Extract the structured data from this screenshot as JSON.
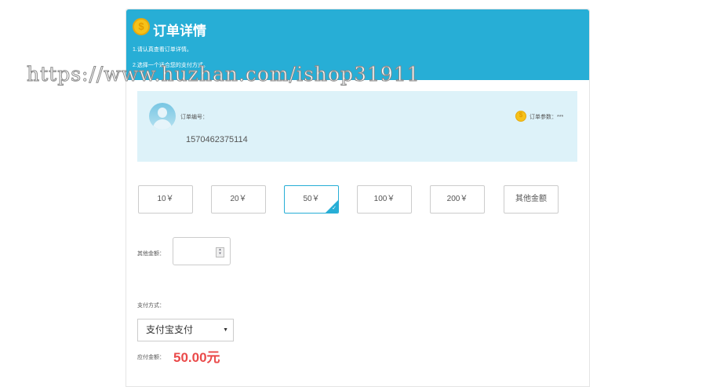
{
  "header": {
    "title": "订单详情",
    "tips": [
      "1.请认真查看订单详情。",
      "2.选择一个适合您的支付方式。"
    ]
  },
  "order": {
    "number_label": "订单编号：",
    "number": "1570462375114",
    "param_label": "订单参数：***"
  },
  "amounts": [
    {
      "label": "10￥"
    },
    {
      "label": "20￥"
    },
    {
      "label": "50￥",
      "selected": true
    },
    {
      "label": "100￥"
    },
    {
      "label": "200￥"
    },
    {
      "label": "其他金额"
    }
  ],
  "other_amount": {
    "label": "其他金额：",
    "value": ""
  },
  "payment": {
    "label": "支付方式：",
    "selected": "支付宝支付"
  },
  "total": {
    "label": "应付金额：",
    "value": "50.00元"
  },
  "watermark": "https://www.huzhan.com/ishop31911",
  "colors": {
    "header": "#27aed6",
    "price": "#ea4a4a"
  }
}
